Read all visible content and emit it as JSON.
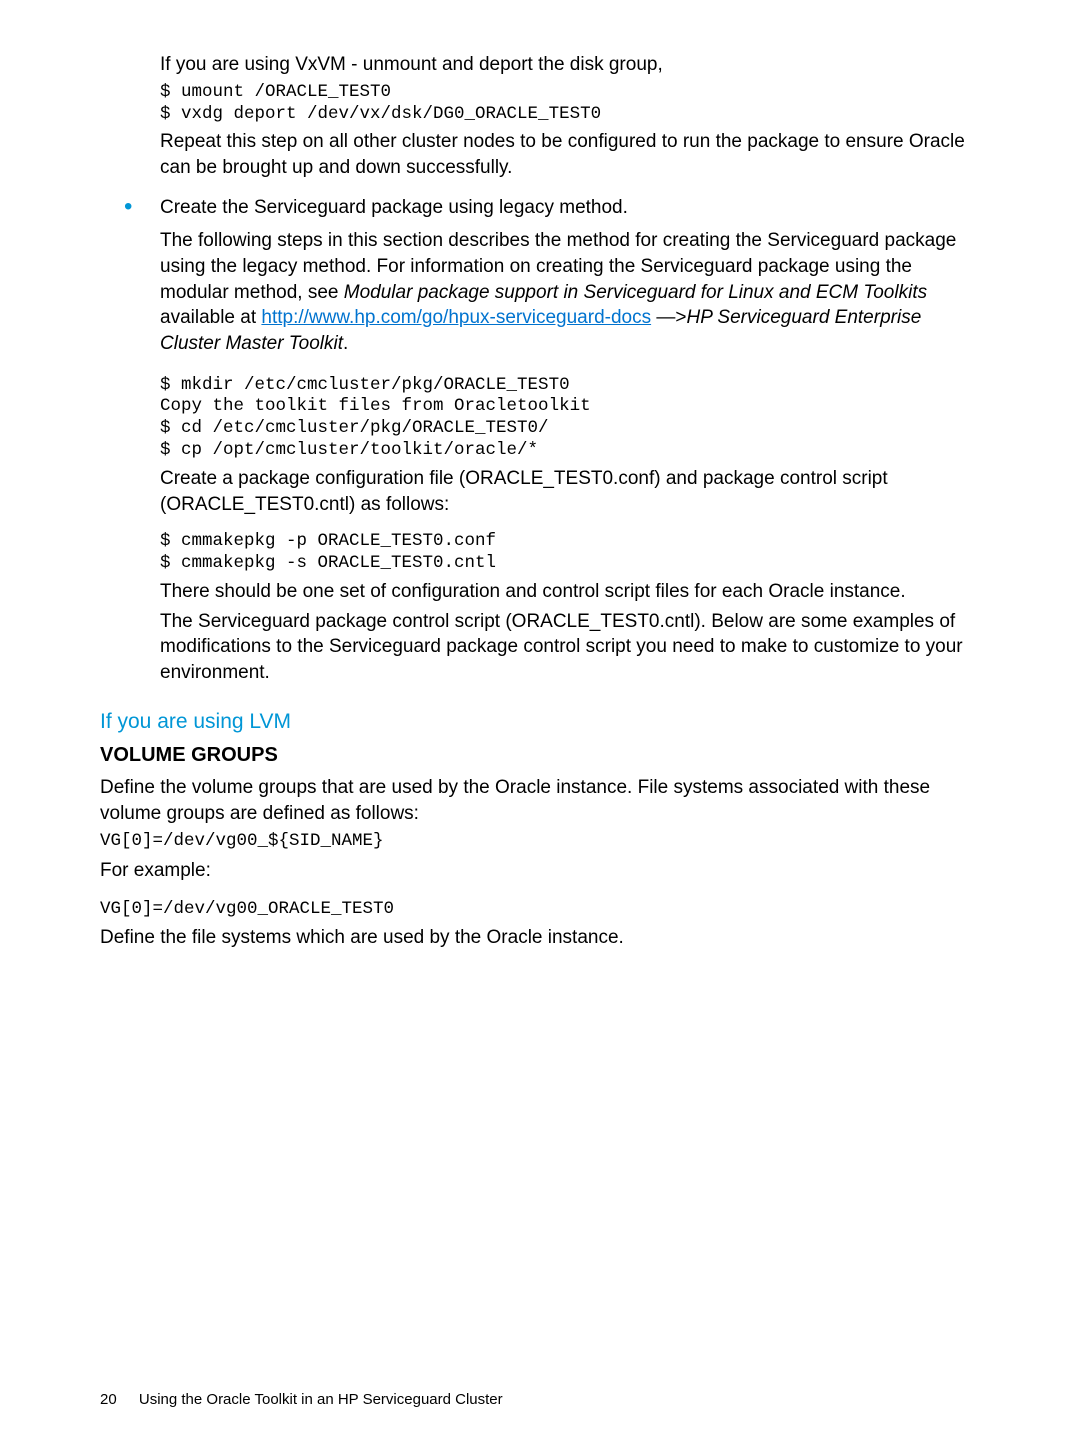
{
  "intro": {
    "vxvm_line": "If you are using VxVM - unmount and deport the disk group,",
    "code1": "$ umount /ORACLE_TEST0\n$ vxdg deport /dev/vx/dsk/DG0_ORACLE_TEST0",
    "repeat_step": "Repeat this step on all other cluster nodes to be configured to run the package to ensure Oracle can be brought up and down successfully."
  },
  "bullet": {
    "title": "Create the Serviceguard package using legacy method.",
    "para_pre": "The following steps in this section describes the method for creating the Serviceguard package using the legacy method. For information on creating the Serviceguard package using the modular method, see ",
    "para_em1": "Modular package support in Serviceguard for Linux and ECM Toolkits",
    "para_mid": " available at ",
    "link_text": "http://www.hp.com/go/hpux-serviceguard-docs",
    "para_arrow": " —>",
    "para_em2": "HP Serviceguard Enterprise Cluster Master Toolkit",
    "para_post": ".",
    "code2": "$ mkdir /etc/cmcluster/pkg/ORACLE_TEST0\nCopy the toolkit files from Oracletoolkit\n$ cd /etc/cmcluster/pkg/ORACLE_TEST0/\n$ cp /opt/cmcluster/toolkit/oracle/*",
    "create_pkg": "Create a package configuration file (ORACLE_TEST0.conf) and package control script (ORACLE_TEST0.cntl) as follows:",
    "code3": "$ cmmakepkg -p ORACLE_TEST0.conf\n$ cmmakepkg -s ORACLE_TEST0.cntl",
    "one_set": "There should be one set of configuration and control script files for each Oracle instance.",
    "sg_pkg": "The Serviceguard package control script (ORACLE_TEST0.cntl). Below are some examples of modifications to the Serviceguard package control script you need to make to customize to your environment."
  },
  "lvm": {
    "heading": "If you are using LVM",
    "vg_heading": "VOLUME GROUPS",
    "vg_define": "Define the volume groups that are used by the Oracle instance. File systems associated with these volume groups are defined as follows:",
    "vg_code1": "VG[0]=/dev/vg00_${SID_NAME}",
    "for_example": "For example:",
    "vg_code2": "VG[0]=/dev/vg00_ORACLE_TEST0",
    "fs_define": "Define the file systems which are used by the Oracle instance."
  },
  "footer": {
    "page": "20",
    "title": "Using the Oracle Toolkit in an HP Serviceguard Cluster"
  }
}
